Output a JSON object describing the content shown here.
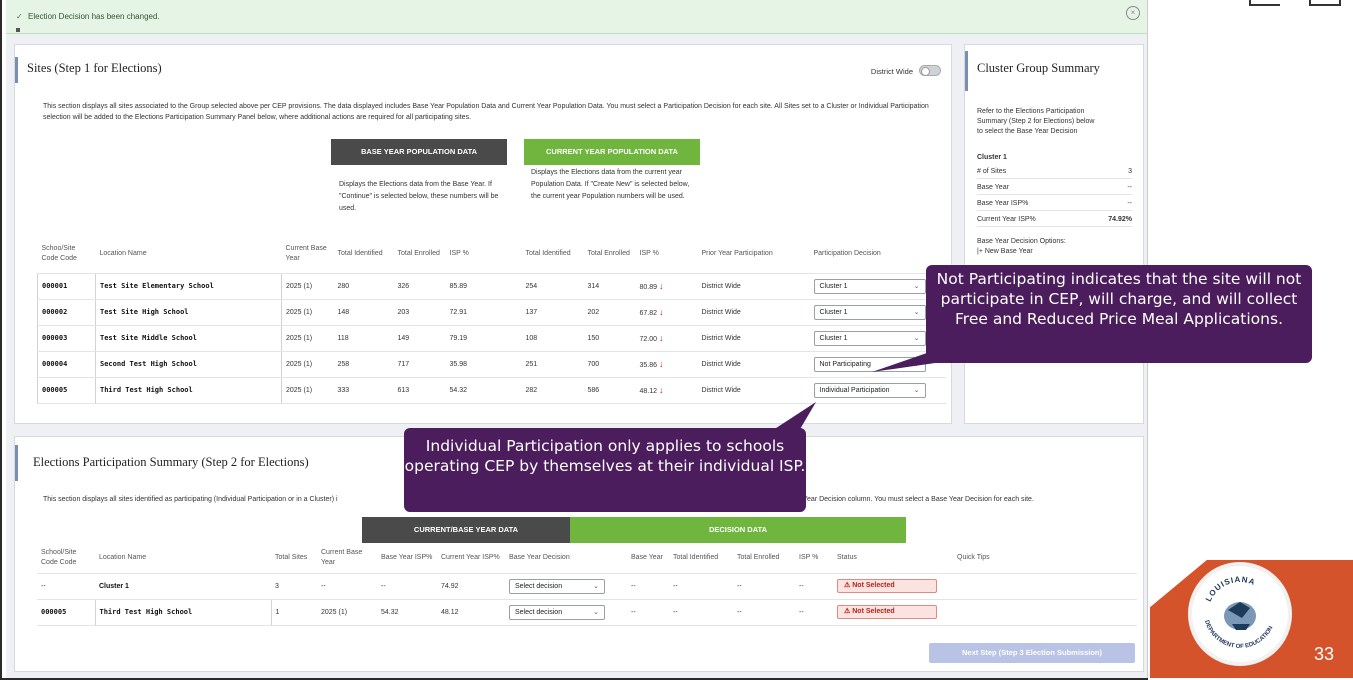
{
  "alert": {
    "message": "Election Decision has been changed.",
    "check": "✓",
    "close": "×"
  },
  "sites": {
    "title": "Sites (Step 1 for Elections)",
    "toggle_label": "District Wide",
    "description": "This section displays all sites associated to the Group selected above per CEP provisions. The data displayed includes Base Year Population Data and Current Year Population Data. You must select a Participation Decision for each site. All Sites set to a Cluster or Individual Participation selection will be added to the Elections Participation Summary Panel below, where additional actions are required for all participating sites.",
    "base_header": "BASE YEAR POPULATION DATA",
    "current_header": "CURRENT YEAR POPULATION DATA",
    "base_desc": "Displays the Elections data from the Base Year. If \"Continue\" is selected below, these numbers will be used.",
    "current_desc": "Displays the Elections data from the current year Population Data. If \"Create New\" is selected below, the current year Population numbers will be used.",
    "columns": [
      "Schoo/Site Code Code",
      "Location Name",
      "Current Base Year",
      "Total Identified",
      "Total Enrolled",
      "ISP %",
      "Total Identified",
      "Total Enrolled",
      "ISP %",
      "Prior Year Participation",
      "Participation Decision"
    ],
    "rows": [
      {
        "code": "000001",
        "name": "Test Site Elementary School",
        "year": "2025 (1)",
        "b_ident": "280",
        "b_enr": "326",
        "b_isp": "85.89",
        "c_ident": "254",
        "c_enr": "314",
        "c_isp": "80.89",
        "prior": "District Wide",
        "decision": "Cluster 1"
      },
      {
        "code": "000002",
        "name": "Test Site High School",
        "year": "2025 (1)",
        "b_ident": "148",
        "b_enr": "203",
        "b_isp": "72.91",
        "c_ident": "137",
        "c_enr": "202",
        "c_isp": "67.82",
        "prior": "District Wide",
        "decision": "Cluster 1"
      },
      {
        "code": "000003",
        "name": "Test Site Middle School",
        "year": "2025 (1)",
        "b_ident": "118",
        "b_enr": "149",
        "b_isp": "79.19",
        "c_ident": "108",
        "c_enr": "150",
        "c_isp": "72.00",
        "prior": "District Wide",
        "decision": "Cluster 1"
      },
      {
        "code": "000004",
        "name": "Second Test High School",
        "year": "2025 (1)",
        "b_ident": "258",
        "b_enr": "717",
        "b_isp": "35.98",
        "c_ident": "251",
        "c_enr": "700",
        "c_isp": "35.86",
        "prior": "District Wide",
        "decision": "Not Participating"
      },
      {
        "code": "000005",
        "name": "Third Test High School",
        "year": "2025 (1)",
        "b_ident": "333",
        "b_enr": "613",
        "b_isp": "54.32",
        "c_ident": "282",
        "c_enr": "586",
        "c_isp": "48.12",
        "prior": "District Wide",
        "decision": "Individual Participation"
      }
    ]
  },
  "cluster": {
    "title": "Cluster Group Summary",
    "intro": [
      "Refer to the Elections Participation",
      "Summary (Step 2 for Elections) below",
      "to select the Base Year Decision"
    ],
    "name": "Cluster 1",
    "items": [
      {
        "k": "# of Sites",
        "v": "3"
      },
      {
        "k": "Base Year",
        "v": "--"
      },
      {
        "k": "Base Year ISP%",
        "v": "--"
      },
      {
        "k": "Current Year ISP%",
        "v": "74.92%"
      }
    ],
    "options_label": "Base Year Decision Options:",
    "option1": "|+ New Base Year"
  },
  "elections": {
    "title": "Elections Participation Summary (Step 2 for Elections)",
    "desc_left": "This section displays all sites identified as participating (Individual Participation or in a Cluster) i",
    "desc_right": "Year Decision column. You must select a Base Year Decision for each site.",
    "band1": "CURRENT/BASE YEAR DATA",
    "band2": "DECISION DATA",
    "columns": [
      "School/Site Code Code",
      "Location Name",
      "Total Sites",
      "Current Base Year",
      "Base Year ISP%",
      "Current Year ISP%",
      "Base Year Decision",
      "Base Year",
      "Total Identified",
      "Total Enrolled",
      "ISP %",
      "Status",
      "Quick Tips"
    ],
    "rows": [
      {
        "code": "--",
        "name": "Cluster 1",
        "sites": "3",
        "cby": "--",
        "byisp": "--",
        "cyisp": "74.92",
        "decision": "Select decision",
        "by": "--",
        "ti": "--",
        "te": "--",
        "isp": "--",
        "status": "Not Selected"
      },
      {
        "code": "000005",
        "name": "Third Test High School",
        "sites": "1",
        "cby": "2025 (1)",
        "byisp": "54.32",
        "cyisp": "48.12",
        "decision": "Select decision",
        "by": "--",
        "ti": "--",
        "te": "--",
        "isp": "--",
        "status": "Not Selected"
      }
    ],
    "next_button": "Next Step (Step 3 Election Submission)"
  },
  "callouts": {
    "not_participating": "Not Participating indicates that the site will not participate in CEP, will charge, and will collect Free and Reduced Price Meal Applications.",
    "individual": "Individual Participation only applies to schools operating CEP by themselves at their individual ISP."
  },
  "slide": {
    "page_number": "33",
    "seal_top": "LOUISIANA",
    "seal_bottom": "DEPARTMENT OF EDUCATION"
  },
  "colors": {
    "purple": "#4b1d5c",
    "green": "#6fb53e",
    "dark": "#4a4a4a",
    "orange": "#d4532a",
    "alert_bg": "#e6f4e6"
  },
  "icons": {
    "down_arrow": "↓",
    "warning": "⚠",
    "chevron": "⌄"
  }
}
